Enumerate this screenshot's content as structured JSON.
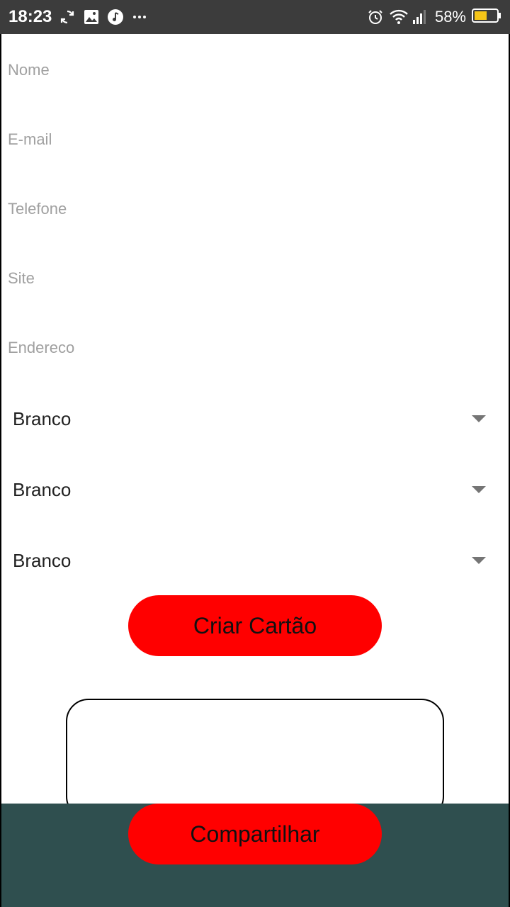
{
  "status_bar": {
    "time": "18:23",
    "battery_percent": "58%",
    "battery_level": 0.58,
    "icons_left": [
      "sync-icon",
      "image-icon",
      "music-icon",
      "more-icon"
    ],
    "icons_right": [
      "alarm-icon",
      "wifi-icon",
      "signal-icon",
      "battery-icon"
    ]
  },
  "form": {
    "nome": {
      "placeholder": "Nome",
      "value": ""
    },
    "email": {
      "placeholder": "E-mail",
      "value": ""
    },
    "telefone": {
      "placeholder": "Telefone",
      "value": ""
    },
    "site": {
      "placeholder": "Site",
      "value": ""
    },
    "endereco": {
      "placeholder": "Endereco",
      "value": ""
    }
  },
  "spinners": [
    {
      "selected": "Branco"
    },
    {
      "selected": "Branco"
    },
    {
      "selected": "Branco"
    }
  ],
  "buttons": {
    "criar": "Criar Cartão",
    "compartilhar": "Compartilhar"
  },
  "colors": {
    "button": "#ff0000",
    "bottom_bar": "#2f4f4f",
    "status_bar": "#3c3c3c",
    "battery_fill": "#f5c518"
  }
}
